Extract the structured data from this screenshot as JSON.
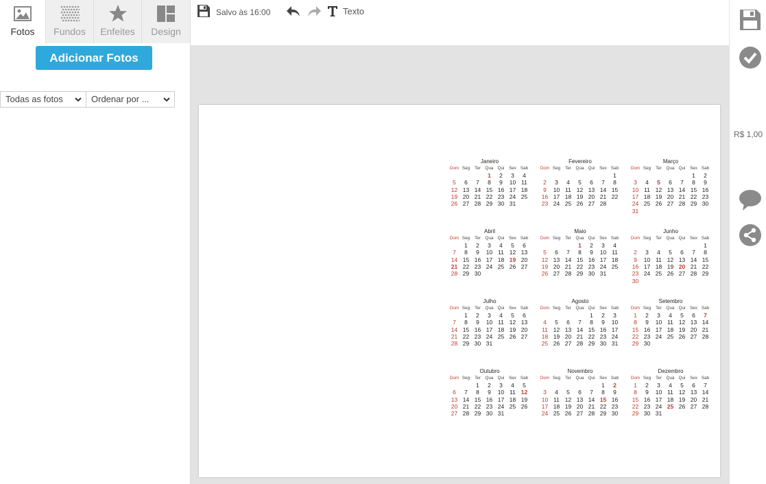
{
  "tabs": [
    {
      "label": "Fotos",
      "icon": "image-icon",
      "active": true
    },
    {
      "label": "Fundos",
      "icon": "pattern-icon",
      "active": false
    },
    {
      "label": "Enfeites",
      "icon": "star-icon",
      "active": false
    },
    {
      "label": "Design",
      "icon": "layout-icon",
      "active": false
    }
  ],
  "left": {
    "add_photos_label": "Adicionar Fotos",
    "filter_value": "Todas as fotos",
    "sort_value": "Ordenar por ..."
  },
  "toolbar": {
    "saved_text": "Salvo às 16:00",
    "text_label": "Texto"
  },
  "right": {
    "price": "R$ 1,00"
  },
  "colors": {
    "accent": "#2fa9dc",
    "sunday": "#c0392b",
    "icon_gray": "#888888"
  },
  "calendar": {
    "weekdays": [
      "Dom",
      "Seg",
      "Ter",
      "Qua",
      "Qui",
      "Sex",
      "Sab"
    ],
    "months": [
      {
        "name": "Janeiro",
        "start": 3,
        "days": 31,
        "holidays": [
          1
        ]
      },
      {
        "name": "Fevereiro",
        "start": 6,
        "days": 28,
        "holidays": []
      },
      {
        "name": "Março",
        "start": 5,
        "days": 31,
        "holidays": [
          5
        ]
      },
      {
        "name": "Abril",
        "start": 1,
        "days": 30,
        "holidays": [
          19,
          21
        ]
      },
      {
        "name": "Maio",
        "start": 3,
        "days": 31,
        "holidays": [
          1
        ]
      },
      {
        "name": "Junho",
        "start": 6,
        "days": 30,
        "holidays": [
          20
        ]
      },
      {
        "name": "Julho",
        "start": 1,
        "days": 31,
        "holidays": []
      },
      {
        "name": "Agosto",
        "start": 4,
        "days": 31,
        "holidays": []
      },
      {
        "name": "Setembro",
        "start": 0,
        "days": 30,
        "holidays": [
          7
        ]
      },
      {
        "name": "Outubro",
        "start": 2,
        "days": 31,
        "holidays": [
          12
        ]
      },
      {
        "name": "Novembro",
        "start": 5,
        "days": 30,
        "holidays": [
          2,
          15
        ]
      },
      {
        "name": "Dezembro",
        "start": 0,
        "days": 31,
        "holidays": [
          25
        ]
      }
    ]
  }
}
